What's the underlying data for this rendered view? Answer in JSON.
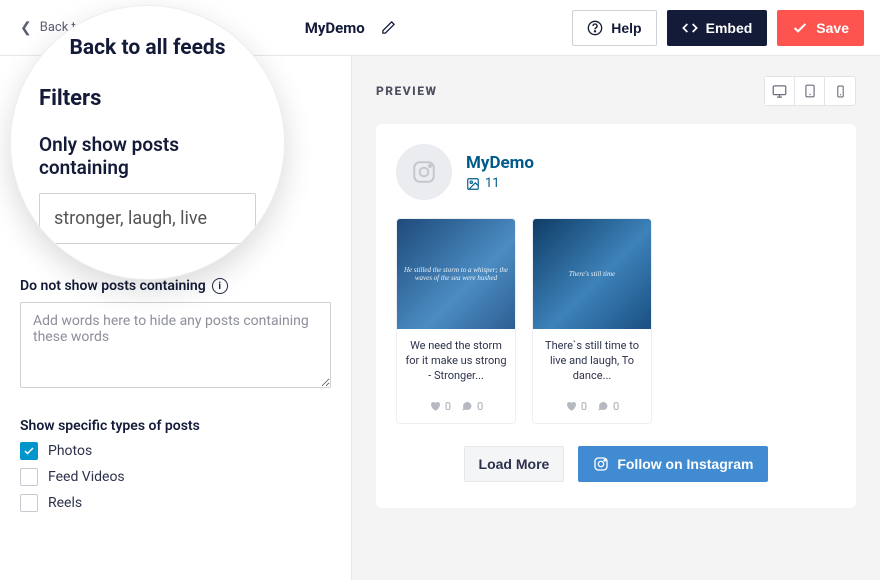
{
  "topbar": {
    "back_label": "Back to all feeds",
    "feed_name": "MyDemo",
    "help_label": "Help",
    "embed_label": "Embed",
    "save_label": "Save"
  },
  "sidebar": {
    "filters_heading": "Filters",
    "show_label": "Only show posts containing",
    "show_value": "stronger, laugh, live",
    "hide_label": "Do not show posts containing",
    "hide_placeholder": "Add words here to hide any posts containing these words",
    "types_heading": "Show specific types of posts",
    "types": [
      {
        "label": "Photos",
        "checked": true
      },
      {
        "label": "Feed Videos",
        "checked": false
      },
      {
        "label": "Reels",
        "checked": false
      }
    ]
  },
  "preview": {
    "label": "PREVIEW",
    "feed_title": "MyDemo",
    "feed_count": "11",
    "posts": [
      {
        "thumb_text": "He stilled the storm to a whisper; the waves of the sea were hushed",
        "caption": "We need the storm for it make us strong - Stronger...",
        "likes": "0",
        "comments": "0"
      },
      {
        "thumb_text": "There's still time",
        "caption": "There`s still time to live and laugh, To dance...",
        "likes": "0",
        "comments": "0"
      }
    ],
    "load_more_label": "Load More",
    "follow_label": "Follow on Instagram"
  },
  "lens": {
    "back_large": "Back to all feeds",
    "filters_large": "Filters",
    "label_large": "Only show posts containing",
    "value_large": "stronger, laugh, live"
  }
}
